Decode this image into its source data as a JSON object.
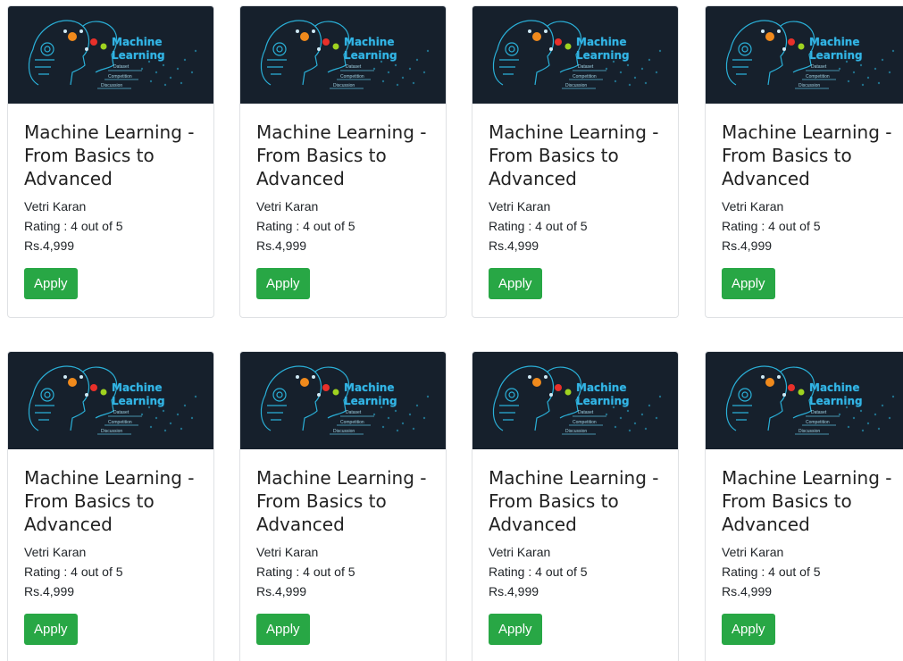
{
  "courses": [
    {
      "banner_title": "Machine\nLearning",
      "banner_labels": [
        "Dataset",
        "Competition",
        "Discussion"
      ],
      "title": "Machine Learning - From Basics to Advanced",
      "author": "Vetri Karan",
      "rating": "Rating : 4 out of 5",
      "price": "Rs.4,999",
      "button": "Apply"
    },
    {
      "banner_title": "Machine\nLearning",
      "banner_labels": [
        "Dataset",
        "Competition",
        "Discussion"
      ],
      "title": "Machine Learning - From Basics to Advanced",
      "author": "Vetri Karan",
      "rating": "Rating : 4 out of 5",
      "price": "Rs.4,999",
      "button": "Apply"
    },
    {
      "banner_title": "Machine\nLearning",
      "banner_labels": [
        "Dataset",
        "Competition",
        "Discussion"
      ],
      "title": "Machine Learning - From Basics to Advanced",
      "author": "Vetri Karan",
      "rating": "Rating : 4 out of 5",
      "price": "Rs.4,999",
      "button": "Apply"
    },
    {
      "banner_title": "Machine\nLearning",
      "banner_labels": [
        "Dataset",
        "Competition",
        "Discussion"
      ],
      "title": "Machine Learning - From Basics to Advanced",
      "author": "Vetri Karan",
      "rating": "Rating : 4 out of 5",
      "price": "Rs.4,999",
      "button": "Apply"
    },
    {
      "banner_title": "Machine\nLearning",
      "banner_labels": [
        "Dataset",
        "Competition",
        "Discussion"
      ],
      "title": "Machine Learning - From Basics to Advanced",
      "author": "Vetri Karan",
      "rating": "Rating : 4 out of 5",
      "price": "Rs.4,999",
      "button": "Apply"
    },
    {
      "banner_title": "Machine\nLearning",
      "banner_labels": [
        "Dataset",
        "Competition",
        "Discussion"
      ],
      "title": "Machine Learning - From Basics to Advanced",
      "author": "Vetri Karan",
      "rating": "Rating : 4 out of 5",
      "price": "Rs.4,999",
      "button": "Apply"
    },
    {
      "banner_title": "Machine\nLearning",
      "banner_labels": [
        "Dataset",
        "Competition",
        "Discussion"
      ],
      "title": "Machine Learning - From Basics to Advanced",
      "author": "Vetri Karan",
      "rating": "Rating : 4 out of 5",
      "price": "Rs.4,999",
      "button": "Apply"
    },
    {
      "banner_title": "Machine\nLearning",
      "banner_labels": [
        "Dataset",
        "Competition",
        "Discussion"
      ],
      "title": "Machine Learning - From Basics to Advanced",
      "author": "Vetri Karan",
      "rating": "Rating : 4 out of 5",
      "price": "Rs.4,999",
      "button": "Apply"
    }
  ],
  "colors": {
    "banner_bg": "#16202c",
    "banner_accent": "#33b5e5",
    "apply_button": "#28a745"
  }
}
